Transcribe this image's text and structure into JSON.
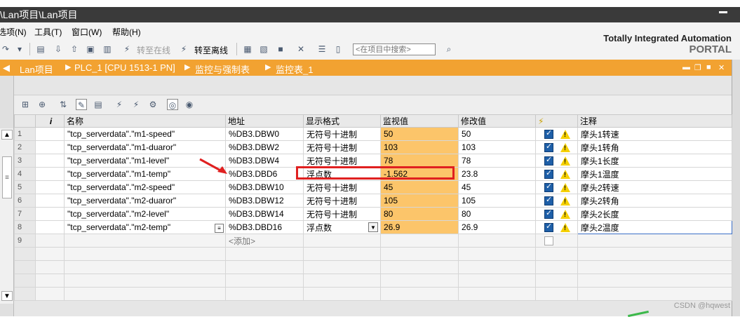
{
  "titlebar": {
    "title": "\\Lan项目\\Lan项目"
  },
  "menu": {
    "items": [
      "选项(N)",
      "工具(T)",
      "窗口(W)",
      "帮助(H)"
    ]
  },
  "toolbar": {
    "go_online": "转至在线",
    "go_offline": "转至离线",
    "search_placeholder": "<在项目中搜索>"
  },
  "branding": {
    "line1": "Totally Integrated Automation",
    "line2": "PORTAL"
  },
  "breadcrumb": {
    "items": [
      "Lan项目",
      "PLC_1 [CPU 1513-1 PN]",
      "监控与强制表",
      "监控表_1"
    ]
  },
  "table": {
    "headers": {
      "i": "i",
      "name": "名称",
      "address": "地址",
      "format": "显示格式",
      "monitor": "监视值",
      "modify": "修改值",
      "comment": "注释"
    },
    "rows": [
      {
        "num": "1",
        "name": "\"tcp_serverdata\".\"m1-speed\"",
        "address": "%DB3.DBW0",
        "format": "无符号十进制",
        "monitor": "50",
        "modify": "50",
        "comment": "摩头1转速"
      },
      {
        "num": "2",
        "name": "\"tcp_serverdata\".\"m1-duaror\"",
        "address": "%DB3.DBW2",
        "format": "无符号十进制",
        "monitor": "103",
        "modify": "103",
        "comment": "摩头1转角"
      },
      {
        "num": "3",
        "name": "\"tcp_serverdata\".\"m1-level\"",
        "address": "%DB3.DBW4",
        "format": "无符号十进制",
        "monitor": "78",
        "modify": "78",
        "comment": "摩头1长度"
      },
      {
        "num": "4",
        "name": "\"tcp_serverdata\".\"m1-temp\"",
        "address": "%DB3.DBD6",
        "format": "浮点数",
        "monitor": "-1.562",
        "modify": "23.8",
        "comment": "摩头1温度"
      },
      {
        "num": "5",
        "name": "\"tcp_serverdata\".\"m2-speed\"",
        "address": "%DB3.DBW10",
        "format": "无符号十进制",
        "monitor": "45",
        "modify": "45",
        "comment": "摩头2转速"
      },
      {
        "num": "6",
        "name": "\"tcp_serverdata\".\"m2-duaror\"",
        "address": "%DB3.DBW12",
        "format": "无符号十进制",
        "monitor": "105",
        "modify": "105",
        "comment": "摩头2转角"
      },
      {
        "num": "7",
        "name": "\"tcp_serverdata\".\"m2-level\"",
        "address": "%DB3.DBW14",
        "format": "无符号十进制",
        "monitor": "80",
        "modify": "80",
        "comment": "摩头2长度"
      },
      {
        "num": "8",
        "name": "\"tcp_serverdata\".\"m2-temp\"",
        "address": "%DB3.DBD16",
        "format": "浮点数",
        "monitor": "26.9",
        "modify": "26.9",
        "comment": "摩头2温度"
      }
    ],
    "add_row": {
      "num": "9",
      "address": "<添加>"
    }
  },
  "watermark": "CSDN @hqwest",
  "colors": {
    "accent": "#f2a231",
    "monitor_cell": "#fcc56a",
    "highlight_box": "#e02020"
  }
}
